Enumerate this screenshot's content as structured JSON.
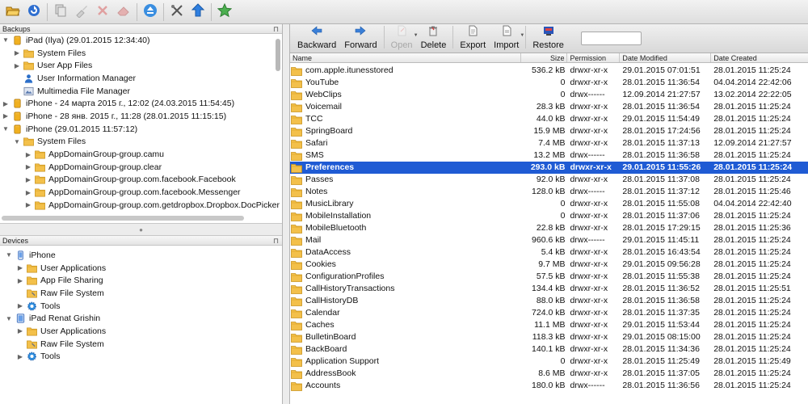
{
  "toolbar": {
    "buttons": [
      {
        "icon": "open-folder-icon"
      },
      {
        "icon": "refresh-icon"
      },
      {
        "icon": "copy-icon"
      },
      {
        "icon": "brush-icon"
      },
      {
        "icon": "delete-x-icon"
      },
      {
        "icon": "eraser-icon"
      },
      {
        "icon": "eject-icon"
      },
      {
        "icon": "tools-icon"
      },
      {
        "icon": "upload-arrow-icon"
      },
      {
        "icon": "star-icon"
      }
    ]
  },
  "backups": {
    "header": "Backups",
    "items": [
      {
        "depth": 0,
        "expand": "open",
        "icon": "backup-icon",
        "label": "iPad (Ilya) (29.01.2015 12:34:40)"
      },
      {
        "depth": 1,
        "expand": "closed",
        "icon": "folder-icon",
        "label": "System Files"
      },
      {
        "depth": 1,
        "expand": "closed",
        "icon": "folder-icon",
        "label": "User App Files"
      },
      {
        "depth": 1,
        "expand": "none",
        "icon": "user-icon",
        "label": "User Information Manager"
      },
      {
        "depth": 1,
        "expand": "none",
        "icon": "media-icon",
        "label": "Multimedia File Manager"
      },
      {
        "depth": 0,
        "expand": "closed",
        "icon": "backup-icon",
        "label": "iPhone - 24 марта 2015 г., 12:02 (24.03.2015 11:54:45)"
      },
      {
        "depth": 0,
        "expand": "closed",
        "icon": "backup-icon",
        "label": "iPhone - 28 янв. 2015 г., 11:28 (28.01.2015 11:15:15)"
      },
      {
        "depth": 0,
        "expand": "open",
        "icon": "backup-icon",
        "label": "iPhone (29.01.2015 11:57:12)"
      },
      {
        "depth": 1,
        "expand": "open",
        "icon": "folder-icon",
        "label": "System Files"
      },
      {
        "depth": 2,
        "expand": "closed",
        "icon": "folder-icon",
        "label": "AppDomainGroup-group.camu"
      },
      {
        "depth": 2,
        "expand": "closed",
        "icon": "folder-icon",
        "label": "AppDomainGroup-group.clear"
      },
      {
        "depth": 2,
        "expand": "closed",
        "icon": "folder-icon",
        "label": "AppDomainGroup-group.com.facebook.Facebook"
      },
      {
        "depth": 2,
        "expand": "closed",
        "icon": "folder-icon",
        "label": "AppDomainGroup-group.com.facebook.Messenger"
      },
      {
        "depth": 2,
        "expand": "closed",
        "icon": "folder-icon",
        "label": "AppDomainGroup-group.com.getdropbox.Dropbox.DocPicker"
      }
    ]
  },
  "devices": {
    "header": "Devices",
    "items": [
      {
        "depth": 0,
        "expand": "open",
        "icon": "phone-icon",
        "label": "iPhone"
      },
      {
        "depth": 1,
        "expand": "closed",
        "icon": "folder-icon",
        "label": "User Applications"
      },
      {
        "depth": 1,
        "expand": "closed",
        "icon": "folder-icon",
        "label": "App File Sharing"
      },
      {
        "depth": 1,
        "expand": "none",
        "icon": "folder-wrench-icon",
        "label": "Raw File System"
      },
      {
        "depth": 1,
        "expand": "closed",
        "icon": "gear-icon",
        "label": "Tools"
      },
      {
        "depth": 0,
        "expand": "open",
        "icon": "ipad-icon",
        "label": "iPad Renat Grishin"
      },
      {
        "depth": 1,
        "expand": "closed",
        "icon": "folder-icon",
        "label": "User Applications"
      },
      {
        "depth": 1,
        "expand": "none",
        "icon": "folder-wrench-icon",
        "label": "Raw File System"
      },
      {
        "depth": 1,
        "expand": "closed",
        "icon": "gear-icon",
        "label": "Tools"
      }
    ]
  },
  "filetoolbar": {
    "buttons": [
      {
        "label": "Backward",
        "icon": "arrow-left-icon",
        "disabled": false,
        "dropdown": false
      },
      {
        "label": "Forward",
        "icon": "arrow-right-icon",
        "disabled": false,
        "dropdown": false
      },
      {
        "label": "Open",
        "icon": "open-doc-icon",
        "disabled": true,
        "dropdown": true
      },
      {
        "label": "Delete",
        "icon": "trash-icon",
        "disabled": false,
        "dropdown": false
      },
      {
        "label": "Export",
        "icon": "export-icon",
        "disabled": false,
        "dropdown": false
      },
      {
        "label": "Import",
        "icon": "import-icon",
        "disabled": false,
        "dropdown": true
      },
      {
        "label": "Restore",
        "icon": "restore-icon",
        "disabled": false,
        "dropdown": false
      }
    ],
    "search_value": ""
  },
  "columns": {
    "name": "Name",
    "size": "Size",
    "permission": "Permission",
    "modified": "Date Modified",
    "created": "Date Created"
  },
  "files": [
    {
      "name": "com.apple.itunesstored",
      "size": "536.2 kB",
      "perm": "drwxr-xr-x",
      "mod": "29.01.2015 07:01:51",
      "cre": "28.01.2015 11:25:24"
    },
    {
      "name": "YouTube",
      "size": "0",
      "perm": "drwxr-xr-x",
      "mod": "28.01.2015 11:36:54",
      "cre": "04.04.2014 22:42:06"
    },
    {
      "name": "WebClips",
      "size": "0",
      "perm": "drwx------",
      "mod": "12.09.2014 21:27:57",
      "cre": "13.02.2014 22:22:05"
    },
    {
      "name": "Voicemail",
      "size": "28.3 kB",
      "perm": "drwxr-xr-x",
      "mod": "28.01.2015 11:36:54",
      "cre": "28.01.2015 11:25:24"
    },
    {
      "name": "TCC",
      "size": "44.0 kB",
      "perm": "drwxr-xr-x",
      "mod": "29.01.2015 11:54:49",
      "cre": "28.01.2015 11:25:24"
    },
    {
      "name": "SpringBoard",
      "size": "15.9 MB",
      "perm": "drwxr-xr-x",
      "mod": "28.01.2015 17:24:56",
      "cre": "28.01.2015 11:25:24"
    },
    {
      "name": "Safari",
      "size": "7.4 MB",
      "perm": "drwxr-xr-x",
      "mod": "28.01.2015 11:37:13",
      "cre": "12.09.2014 21:27:57"
    },
    {
      "name": "SMS",
      "size": "13.2 MB",
      "perm": "drwx------",
      "mod": "28.01.2015 11:36:58",
      "cre": "28.01.2015 11:25:24"
    },
    {
      "name": "Preferences",
      "size": "293.0 kB",
      "perm": "drwxr-xr-x",
      "mod": "29.01.2015 11:55:26",
      "cre": "28.01.2015 11:25:24",
      "selected": true
    },
    {
      "name": "Passes",
      "size": "92.0 kB",
      "perm": "drwxr-xr-x",
      "mod": "28.01.2015 11:37:08",
      "cre": "28.01.2015 11:25:24"
    },
    {
      "name": "Notes",
      "size": "128.0 kB",
      "perm": "drwx------",
      "mod": "28.01.2015 11:37:12",
      "cre": "28.01.2015 11:25:46"
    },
    {
      "name": "MusicLibrary",
      "size": "0",
      "perm": "drwxr-xr-x",
      "mod": "28.01.2015 11:55:08",
      "cre": "04.04.2014 22:42:40"
    },
    {
      "name": "MobileInstallation",
      "size": "0",
      "perm": "drwxr-xr-x",
      "mod": "28.01.2015 11:37:06",
      "cre": "28.01.2015 11:25:24"
    },
    {
      "name": "MobileBluetooth",
      "size": "22.8 kB",
      "perm": "drwxr-xr-x",
      "mod": "28.01.2015 17:29:15",
      "cre": "28.01.2015 11:25:36"
    },
    {
      "name": "Mail",
      "size": "960.6 kB",
      "perm": "drwx------",
      "mod": "29.01.2015 11:45:11",
      "cre": "28.01.2015 11:25:24"
    },
    {
      "name": "DataAccess",
      "size": "5.4 kB",
      "perm": "drwxr-xr-x",
      "mod": "28.01.2015 16:43:54",
      "cre": "28.01.2015 11:25:24"
    },
    {
      "name": "Cookies",
      "size": "9.7 MB",
      "perm": "drwxr-xr-x",
      "mod": "29.01.2015 09:56:28",
      "cre": "28.01.2015 11:25:24"
    },
    {
      "name": "ConfigurationProfiles",
      "size": "57.5 kB",
      "perm": "drwxr-xr-x",
      "mod": "28.01.2015 11:55:38",
      "cre": "28.01.2015 11:25:24"
    },
    {
      "name": "CallHistoryTransactions",
      "size": "134.4 kB",
      "perm": "drwxr-xr-x",
      "mod": "28.01.2015 11:36:52",
      "cre": "28.01.2015 11:25:51"
    },
    {
      "name": "CallHistoryDB",
      "size": "88.0 kB",
      "perm": "drwxr-xr-x",
      "mod": "28.01.2015 11:36:58",
      "cre": "28.01.2015 11:25:24"
    },
    {
      "name": "Calendar",
      "size": "724.0 kB",
      "perm": "drwxr-xr-x",
      "mod": "28.01.2015 11:37:35",
      "cre": "28.01.2015 11:25:24"
    },
    {
      "name": "Caches",
      "size": "11.1 MB",
      "perm": "drwxr-xr-x",
      "mod": "29.01.2015 11:53:44",
      "cre": "28.01.2015 11:25:24"
    },
    {
      "name": "BulletinBoard",
      "size": "118.3 kB",
      "perm": "drwxr-xr-x",
      "mod": "29.01.2015 08:15:00",
      "cre": "28.01.2015 11:25:24"
    },
    {
      "name": "BackBoard",
      "size": "140.1 kB",
      "perm": "drwxr-xr-x",
      "mod": "28.01.2015 11:34:36",
      "cre": "28.01.2015 11:25:24"
    },
    {
      "name": "Application Support",
      "size": "0",
      "perm": "drwxr-xr-x",
      "mod": "28.01.2015 11:25:49",
      "cre": "28.01.2015 11:25:49"
    },
    {
      "name": "AddressBook",
      "size": "8.6 MB",
      "perm": "drwxr-xr-x",
      "mod": "28.01.2015 11:37:05",
      "cre": "28.01.2015 11:25:24"
    },
    {
      "name": "Accounts",
      "size": "180.0 kB",
      "perm": "drwx------",
      "mod": "28.01.2015 11:36:56",
      "cre": "28.01.2015 11:25:24"
    }
  ],
  "colors": {
    "selection": "#1f5bd4",
    "folder": "#f3c04a"
  }
}
